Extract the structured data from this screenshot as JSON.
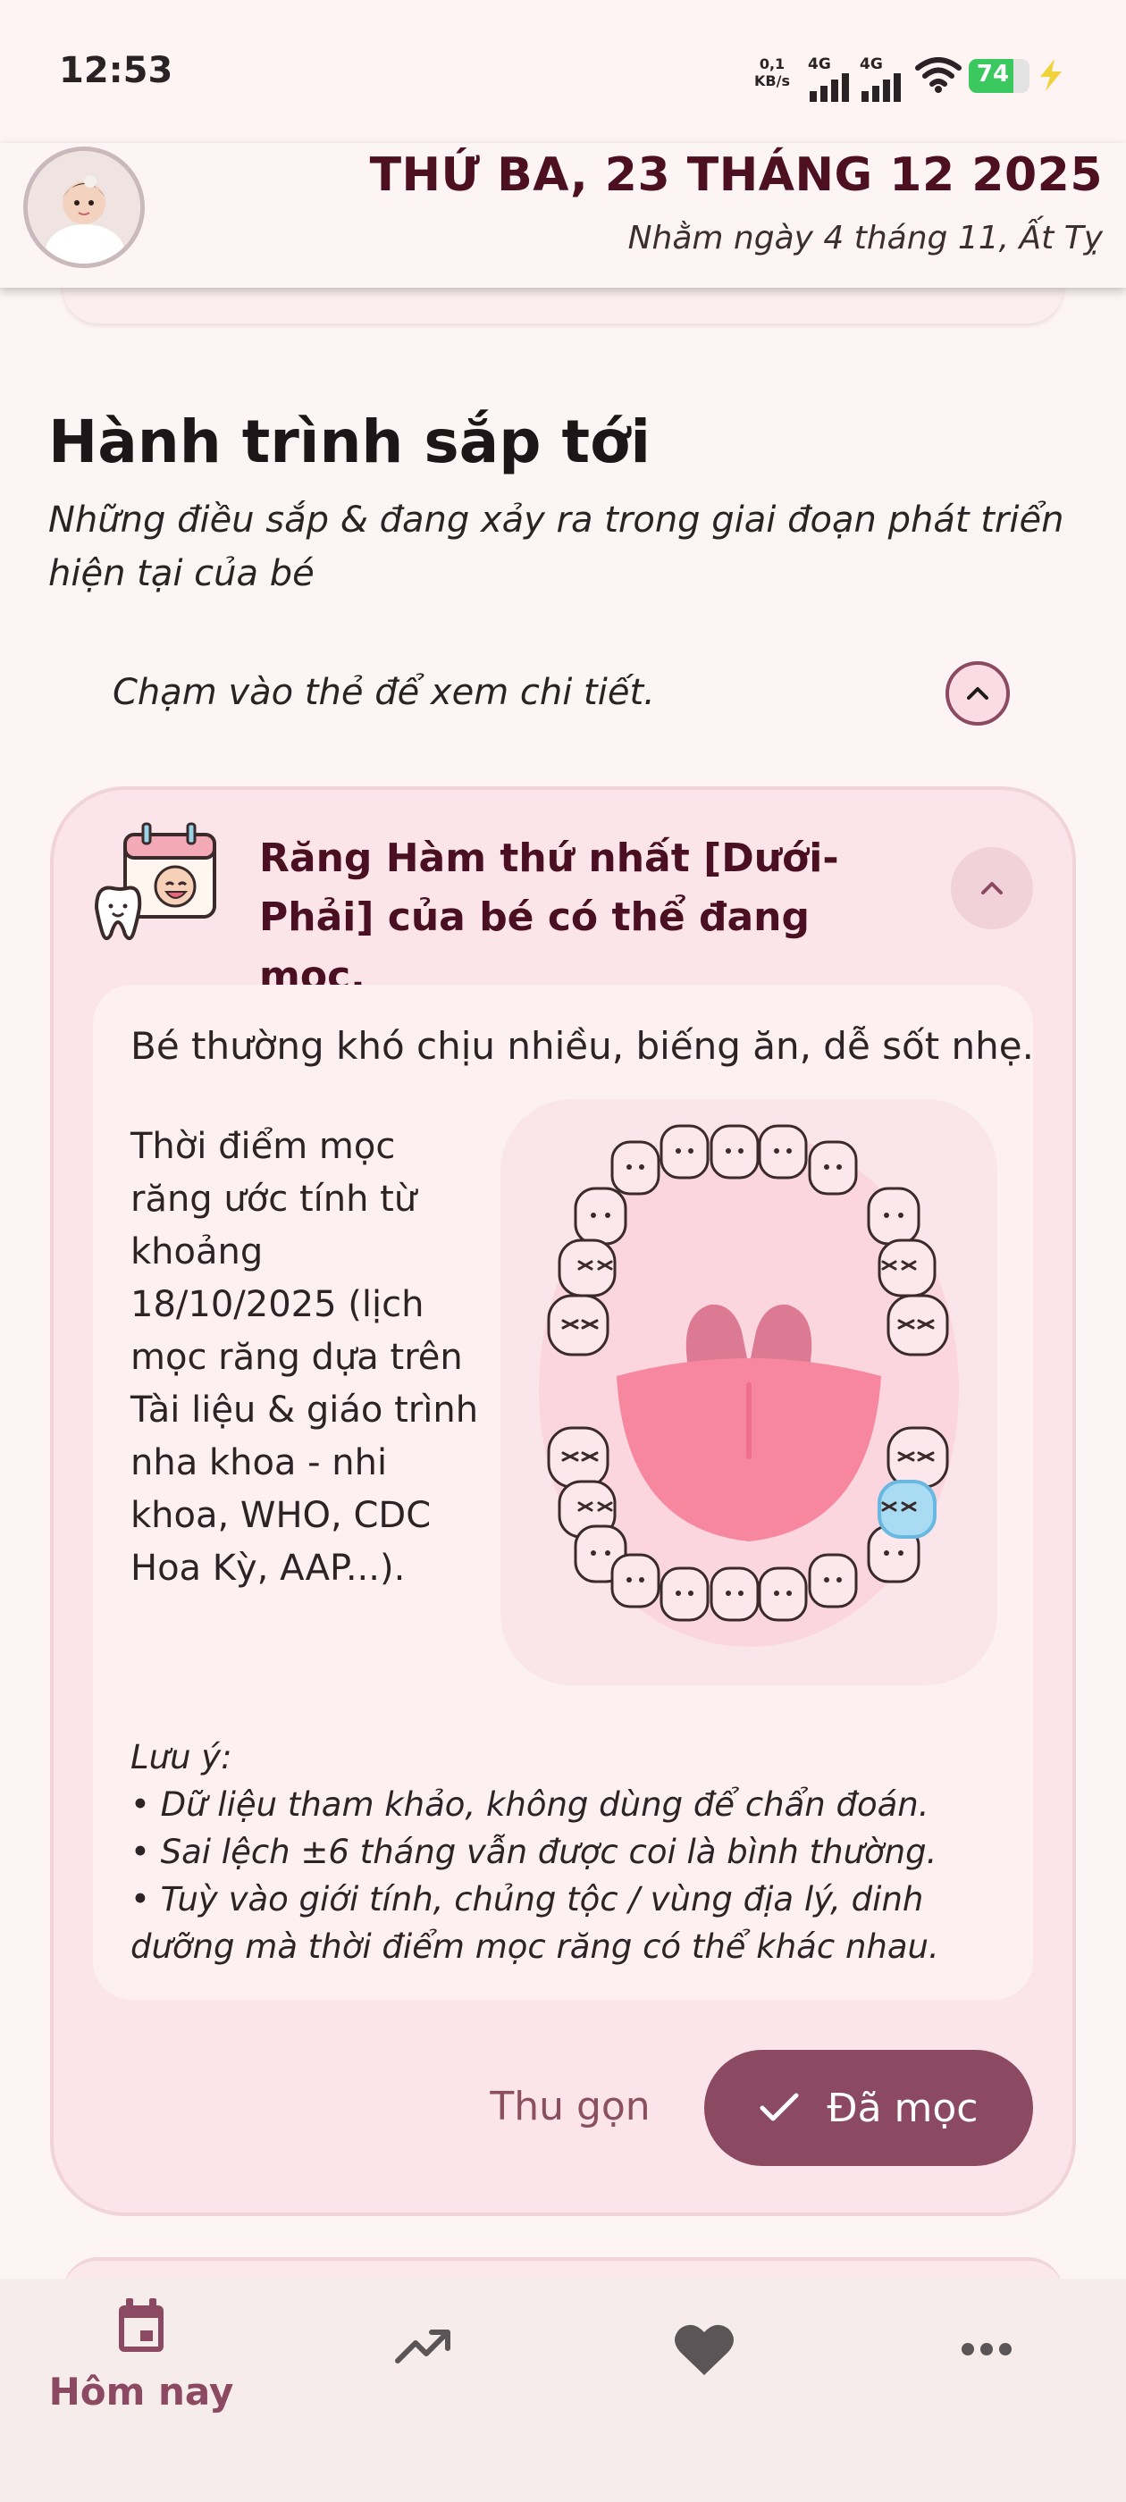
{
  "status_bar": {
    "time": "12:53",
    "net_speed_value": "0,1",
    "net_speed_unit": "KB/s",
    "signal_1_label": "4G",
    "signal_2_label": "4G",
    "battery_level": "74",
    "battery_color": "#3bc95f",
    "charging_icon": "bolt-icon"
  },
  "header": {
    "date_title": "THỨ BA, 23 THÁNG 12 2025",
    "lunar_date": "Nhằm ngày 4 tháng 11, Ất Tỵ",
    "accent_color": "#4d0f22"
  },
  "section": {
    "title": "Hành trình sắp tới",
    "subtitle": "Những điều sắp & đang xảy ra trong giai đoạn phát triển hiện tại của bé",
    "hint": "Chạm vào thẻ để xem chi tiết."
  },
  "card": {
    "title": "Răng Hàm thứ nhất [Dưới-Phải] của bé có thể đang mọc.",
    "symptom": "Bé thường khó chịu nhiều, biếng ăn, dễ sốt nhẹ.",
    "estimate": "Thời điểm mọc răng ước tính từ khoảng 18/10/2025 (lịch mọc răng dựa trên Tài liệu & giáo trình nha khoa - nhi khoa, WHO, CDC Hoa Kỳ, AAP...).",
    "note_title": "Lưu ý:",
    "notes": [
      "• Dữ liệu tham khảo, không dùng để chẩn đoán.",
      "• Sai lệch ±6 tháng vẫn được coi là bình thường.",
      "• Tuỳ vào giới tính, chủng tộc / vùng địa lý, dinh dưỡng mà thời điểm mọc răng có thể khác nhau."
    ],
    "collapse_label": "Thu gọn",
    "done_label": "Đã mọc",
    "primary_color": "#8b4a62",
    "highlight_tooth_color": "#a9dcf3"
  },
  "bottom_nav": {
    "items": [
      {
        "label": "Hôm nay",
        "icon": "calendar-icon",
        "active": true
      },
      {
        "label": "",
        "icon": "trending-up-icon",
        "active": false
      },
      {
        "label": "",
        "icon": "heart-icon",
        "active": false
      },
      {
        "label": "",
        "icon": "more-horizontal-icon",
        "active": false
      }
    ]
  }
}
